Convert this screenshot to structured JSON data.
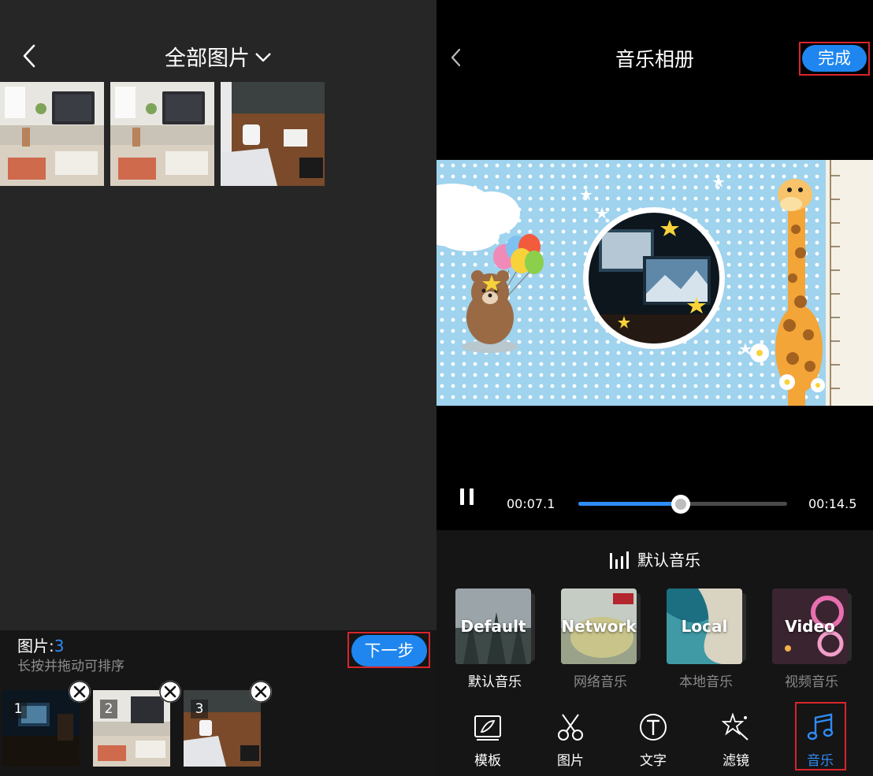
{
  "left_panel": {
    "title": "全部图片",
    "count_label": "图片:",
    "count_value": "3",
    "hint": "长按并拖动可排序",
    "next_button": "下一步",
    "selected_items": [
      {
        "index": "1"
      },
      {
        "index": "2"
      },
      {
        "index": "3"
      }
    ]
  },
  "right_panel": {
    "title": "音乐相册",
    "done_button": "完成",
    "player": {
      "current_time": "00:07.1",
      "total_time": "00:14.5",
      "progress": 0.49
    },
    "music_section": {
      "header": "默认音乐",
      "cards": [
        {
          "label": "Default",
          "caption": "默认音乐"
        },
        {
          "label": "Network",
          "caption": "网络音乐"
        },
        {
          "label": "Local",
          "caption": "本地音乐"
        },
        {
          "label": "Video",
          "caption": "视频音乐"
        }
      ]
    },
    "toolbar": [
      {
        "label": "模板",
        "icon": "template-icon"
      },
      {
        "label": "图片",
        "icon": "scissors-icon"
      },
      {
        "label": "文字",
        "icon": "text-icon"
      },
      {
        "label": "滤镜",
        "icon": "magic-wand-icon"
      },
      {
        "label": "音乐",
        "icon": "music-note-icon",
        "active": true
      }
    ]
  },
  "colors": {
    "accent": "#1f86f0",
    "highlight_box": "#d9252b",
    "inactive_caption": "#8a8a8a"
  }
}
